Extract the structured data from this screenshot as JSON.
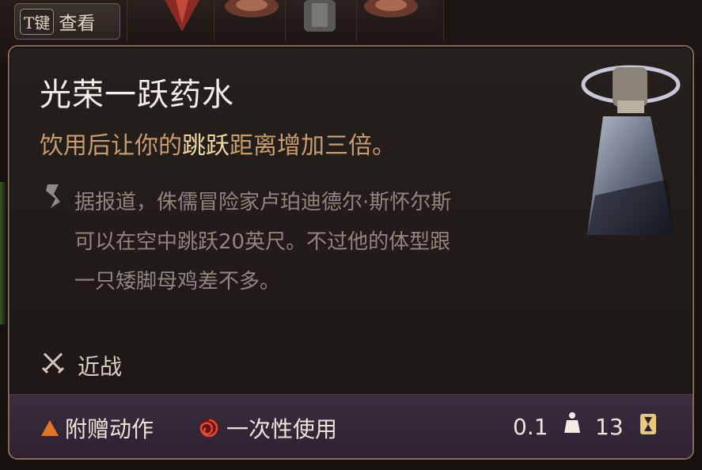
{
  "hotbar": {
    "hint_key": "T键",
    "hint_label": "查看"
  },
  "tooltip": {
    "title": "光荣一跃药水",
    "desc_before": "饮用后让你的",
    "desc_highlight": "跳跃",
    "desc_after": "距离增加三倍。",
    "lore": "据报道，侏儒冒险家卢珀迪德尔·斯怀尔斯可以在空中跳跃20英尺。不过他的体型跟一只矮脚母鸡差不多。",
    "attack_type": "近战",
    "footer": {
      "bonus_action": "附赠动作",
      "single_use": "一次性使用",
      "weight": "0.1",
      "value": "13"
    }
  },
  "colors": {
    "title": "#f4efe7",
    "description": "#c99c6e",
    "highlight": "#f2d7a0",
    "lore": "#8f867d",
    "border": "#8a6a4c",
    "footer_bg": "#2d2232",
    "bonus_action_icon": "#e0742a"
  },
  "icons": {
    "potion": "potion-bottle",
    "lore": "scroll-icon",
    "melee": "crossed-swords-icon",
    "bonus_action": "triangle-icon",
    "single_use": "spiral-icon",
    "weight": "weight-icon",
    "value": "hourglass-icon"
  }
}
